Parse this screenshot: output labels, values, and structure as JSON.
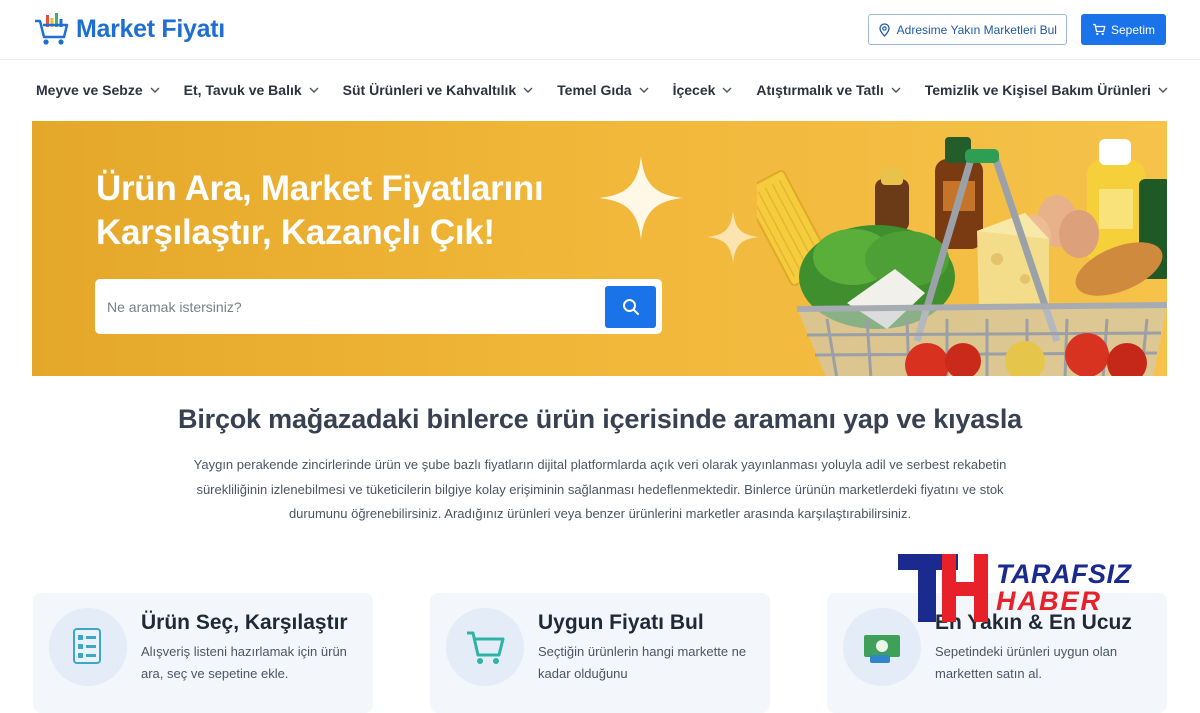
{
  "header": {
    "logo_text": "Market Fiyatı",
    "nearby_button": "Adresime Yakın Marketleri Bul",
    "cart_button": "Sepetim"
  },
  "nav": {
    "items": [
      {
        "label": "Meyve ve Sebze"
      },
      {
        "label": "Et, Tavuk ve Balık"
      },
      {
        "label": "Süt Ürünleri ve Kahvaltılık"
      },
      {
        "label": "Temel Gıda"
      },
      {
        "label": "İçecek"
      },
      {
        "label": "Atıştırmalık ve Tatlı"
      },
      {
        "label": "Temizlik ve Kişisel Bakım Ürünleri"
      }
    ]
  },
  "hero": {
    "title": "Ürün Ara, Market Fiyatlarını Karşılaştır, Kazançlı Çık!",
    "search_placeholder": "Ne aramak istersiniz?"
  },
  "section": {
    "title": "Birçok mağazadaki binlerce ürün içerisinde aramanı yap ve kıyasla",
    "description": "Yaygın perakende zincirlerinde ürün ve şube bazlı fiyatların dijital platformlarda açık veri olarak yayınlanması yoluyla adil ve serbest rekabetin sürekliliğinin izlenebilmesi ve tüketicilerin bilgiye kolay erişiminin sağlanması hedeflenmektedir. Binlerce ürünün marketlerdeki fiyatını ve stok durumunu öğrenebilirsiniz. Aradığınız ürünleri veya benzer ürünlerini marketler arasında karşılaştırabilirsiniz."
  },
  "cards": [
    {
      "title": "Ürün Seç, Karşılaştır",
      "text": "Alışveriş listeni hazırlamak için ürün ara, seç ve sepetine ekle.",
      "icon": "checklist-icon"
    },
    {
      "title": "Uygun Fiyatı Bul",
      "text": "Seçtiğin ürünlerin hangi markette ne kadar olduğunu",
      "icon": "cart-icon"
    },
    {
      "title": "En Yakın & En Ucuz",
      "text": "Sepetindeki ürünleri uygun olan marketten satın al.",
      "icon": "money-icon"
    }
  ],
  "watermark": {
    "line1": "TARAFSIZ",
    "line2": "HABER"
  },
  "colors": {
    "brand_blue": "#1a73e8",
    "hero_yellow": "#f0b638",
    "watermark_navy": "#1a2a8f",
    "watermark_red": "#e8202a"
  }
}
